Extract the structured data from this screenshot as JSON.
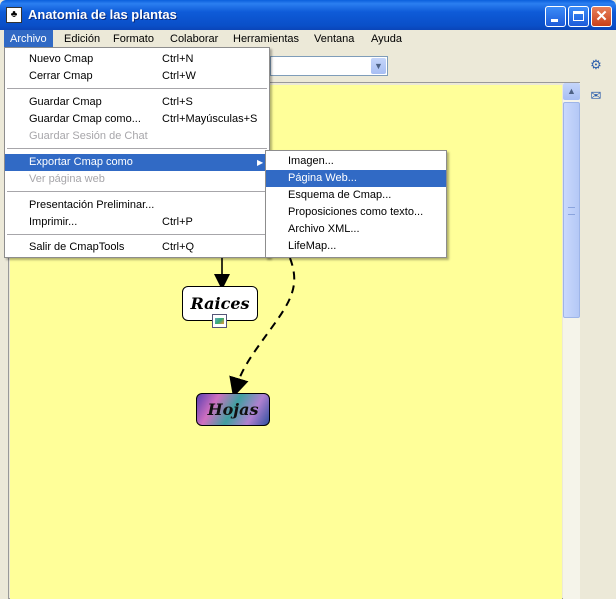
{
  "window": {
    "title": "Anatomia de las plantas",
    "icon": "cmap-app-icon",
    "close_glyph": "✕"
  },
  "menubar": [
    {
      "label": "Archivo",
      "active": true
    },
    {
      "label": "Edición"
    },
    {
      "label": "Formato"
    },
    {
      "label": "Colaborar"
    },
    {
      "label": "Herramientas"
    },
    {
      "label": "Ventana"
    },
    {
      "label": "Ayuda"
    }
  ],
  "archivo_menu": [
    {
      "label": "Nuevo Cmap",
      "shortcut": "Ctrl+N"
    },
    {
      "label": "Cerrar Cmap",
      "shortcut": "Ctrl+W"
    },
    {
      "label": "Guardar Cmap",
      "shortcut": "Ctrl+S"
    },
    {
      "label": "Guardar Cmap como...",
      "shortcut": "Ctrl+Mayúsculas+S"
    },
    {
      "label": "Guardar Sesión de Chat",
      "shortcut": "",
      "disabled": true
    },
    {
      "label": "Exportar Cmap como",
      "shortcut": "",
      "submenu": true,
      "highlighted": true
    },
    {
      "label": "Ver página web",
      "shortcut": "",
      "disabled": true
    },
    {
      "label": "Presentación Preliminar...",
      "shortcut": ""
    },
    {
      "label": "Imprimir...",
      "shortcut": "Ctrl+P"
    },
    {
      "label": "Salir de CmapTools",
      "shortcut": "Ctrl+Q"
    }
  ],
  "export_submenu": [
    {
      "label": "Imagen..."
    },
    {
      "label": "Página Web...",
      "highlighted": true
    },
    {
      "label": "Esquema de Cmap..."
    },
    {
      "label": "Proposiciones como texto..."
    },
    {
      "label": "Archivo XML..."
    },
    {
      "label": "LifeMap..."
    }
  ],
  "concepts": {
    "raices": "Raices",
    "hojas": "Hojas"
  },
  "toolbar": {
    "combo_value": ""
  },
  "colors": {
    "canvas": "#FFFF99",
    "highlight": "#316AC5",
    "titlebar": "#0A5FDC"
  }
}
